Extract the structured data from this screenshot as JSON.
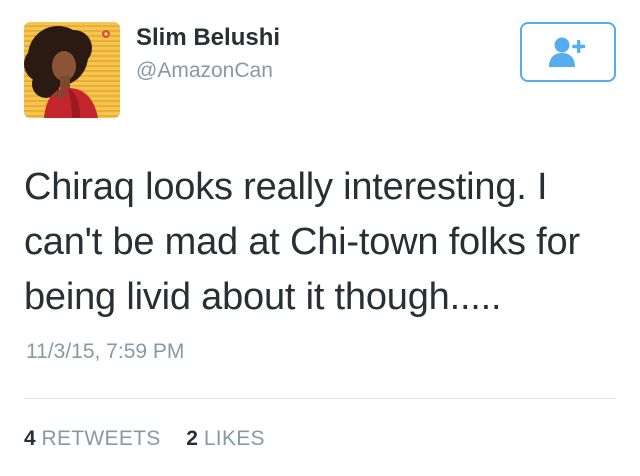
{
  "user": {
    "display_name": "Slim Belushi",
    "handle": "@AmazonCan",
    "avatar_icon": "profile-avatar-illustration"
  },
  "follow_button": {
    "icon": "follow-user-plus-icon",
    "color": "#55acee"
  },
  "tweet": {
    "text": "Chiraq looks really interesting. I can't be mad at Chi-town folks for being livid about it though.....",
    "timestamp": "11/3/15, 7:59 PM"
  },
  "stats": {
    "retweets_count": "4",
    "retweets_label": "RETWEETS",
    "likes_count": "2",
    "likes_label": "LIKES"
  },
  "colors": {
    "text": "#292f33",
    "secondary": "#8899a6",
    "accent": "#55acee",
    "divider": "#e1e8ed"
  }
}
